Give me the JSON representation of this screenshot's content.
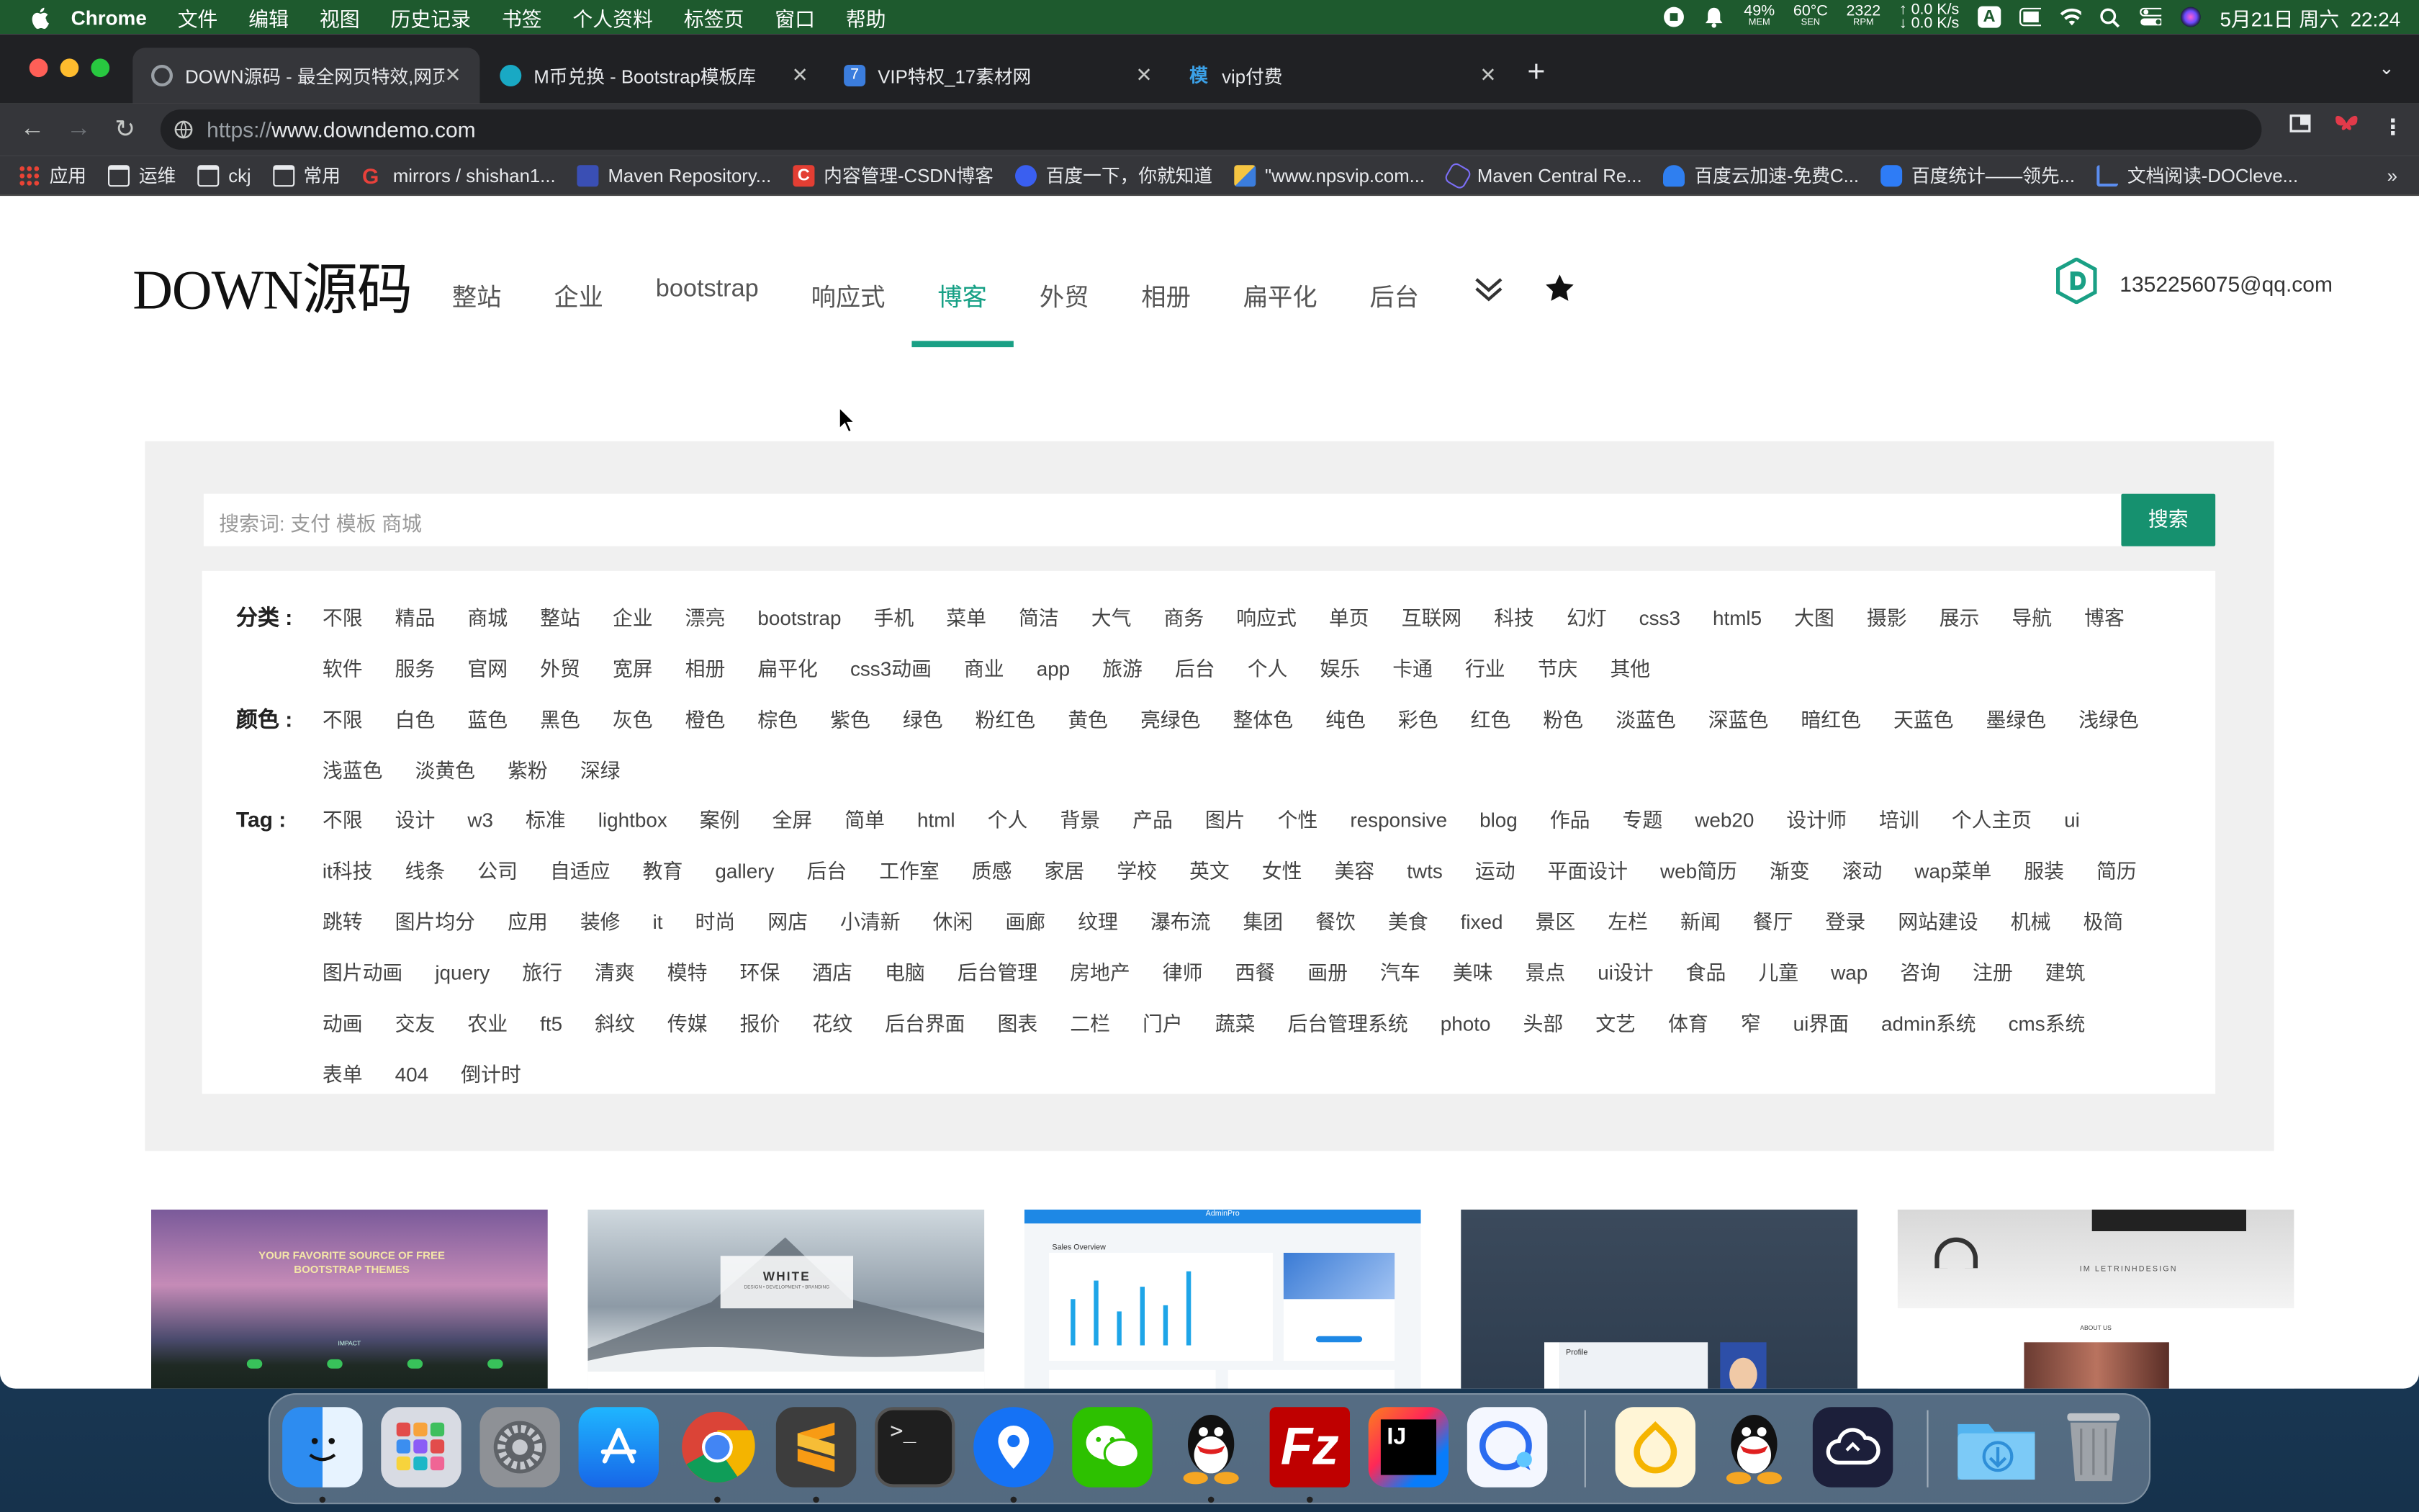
{
  "menubar": {
    "app": "Chrome",
    "items": [
      "文件",
      "编辑",
      "视图",
      "历史记录",
      "书签",
      "个人资料",
      "标签页",
      "窗口",
      "帮助"
    ],
    "mem": "49%",
    "mem_label": "MEM",
    "temp": "60°C",
    "temp_label": "SEN",
    "fan": "2322",
    "fan_label": "RPM",
    "net_up": "0.0 K/s",
    "net_down": "0.0 K/s",
    "input_method": "A",
    "datetime": "5月21日 周六  22:24"
  },
  "browser": {
    "tabs": [
      {
        "title": "DOWN源码 - 最全网页特效,网页",
        "active": true
      },
      {
        "title": "M币兑换 - Bootstrap模板库",
        "active": false
      },
      {
        "title": "VIP特权_17素材网",
        "active": false
      },
      {
        "title": "vip付费",
        "active": false
      }
    ],
    "url_protocol": "https://",
    "url_host": "www.downdemo.com",
    "bookmarks": [
      "应用",
      "运维",
      "ckj",
      "常用",
      "mirrors / shishan1...",
      "Maven Repository...",
      "内容管理-CSDN博客",
      "百度一下，你就知道",
      "\"www.npsvip.com...",
      "Maven Central Re...",
      "百度云加速-免费C...",
      "百度统计——领先...",
      "文档阅读-DOCleve..."
    ],
    "bookmarks_more": "»"
  },
  "site": {
    "logo": "DOWN源码",
    "nav": [
      {
        "label": "整站"
      },
      {
        "label": "企业"
      },
      {
        "label": "bootstrap"
      },
      {
        "label": "响应式"
      },
      {
        "label": "博客",
        "active": true
      },
      {
        "label": "外贸"
      },
      {
        "label": "相册"
      },
      {
        "label": "扁平化"
      },
      {
        "label": "后台"
      }
    ],
    "user_email": "1352256075@qq.com",
    "accent": "#16a085",
    "search_placeholder": "搜索词: 支付 模板 商城",
    "search_button": "搜索"
  },
  "filters": {
    "category": {
      "label": "分类 :",
      "options": [
        "不限",
        "精品",
        "商城",
        "整站",
        "企业",
        "漂亮",
        "bootstrap",
        "手机",
        "菜单",
        "简洁",
        "大气",
        "商务",
        "响应式",
        "单页",
        "互联网",
        "科技",
        "幻灯",
        "css3",
        "html5",
        "大图",
        "摄影",
        "展示",
        "导航",
        "博客",
        "软件",
        "服务",
        "官网",
        "外贸",
        "宽屏",
        "相册",
        "扁平化",
        "css3动画",
        "商业",
        "app",
        "旅游",
        "后台",
        "个人",
        "娱乐",
        "卡通",
        "行业",
        "节庆",
        "其他"
      ]
    },
    "color": {
      "label": "颜色 :",
      "options": [
        "不限",
        "白色",
        "蓝色",
        "黑色",
        "灰色",
        "橙色",
        "棕色",
        "紫色",
        "绿色",
        "粉红色",
        "黄色",
        "亮绿色",
        "整体色",
        "纯色",
        "彩色",
        "红色",
        "粉色",
        "淡蓝色",
        "深蓝色",
        "暗红色",
        "天蓝色",
        "墨绿色",
        "浅绿色",
        "浅蓝色",
        "淡黄色",
        "紫粉",
        "深绿"
      ]
    },
    "tag": {
      "label": "Tag :",
      "options": [
        "不限",
        "设计",
        "w3",
        "标准",
        "lightbox",
        "案例",
        "全屏",
        "简单",
        "html",
        "个人",
        "背景",
        "产品",
        "图片",
        "个性",
        "responsive",
        "blog",
        "作品",
        "专题",
        "web20",
        "设计师",
        "培训",
        "个人主页",
        "ui",
        "it科技",
        "线条",
        "公司",
        "自适应",
        "教育",
        "gallery",
        "后台",
        "工作室",
        "质感",
        "家居",
        "学校",
        "英文",
        "女性",
        "美容",
        "twts",
        "运动",
        "平面设计",
        "web简历",
        "渐变",
        "滚动",
        "wap菜单",
        "服装",
        "简历",
        "跳转",
        "图片均分",
        "应用",
        "装修",
        "it",
        "时尚",
        "网店",
        "小清新",
        "休闲",
        "画廊",
        "纹理",
        "瀑布流",
        "集团",
        "餐饮",
        "美食",
        "fixed",
        "景区",
        "左栏",
        "新闻",
        "餐厅",
        "登录",
        "网站建设",
        "机械",
        "极简",
        "图片动画",
        "jquery",
        "旅行",
        "清爽",
        "模特",
        "环保",
        "酒店",
        "电脑",
        "后台管理",
        "房地产",
        "律师",
        "西餐",
        "画册",
        "汽车",
        "美味",
        "景点",
        "ui设计",
        "食品",
        "儿童",
        "wap",
        "咨询",
        "注册",
        "建筑",
        "动画",
        "交友",
        "农业",
        "ft5",
        "斜纹",
        "传媒",
        "报价",
        "花纹",
        "后台界面",
        "图表",
        "二栏",
        "门户",
        "蔬菜",
        "后台管理系统",
        "photo",
        "头部",
        "文艺",
        "体育",
        "窄",
        "ui界面",
        "admin系统",
        "cms系统",
        "表单",
        "404",
        "倒计时"
      ]
    }
  },
  "thumbnails": [
    {
      "caption": "YOUR FAVORITE SOURCE OF FREE BOOTSTRAP THEMES",
      "sub": "IMPACT"
    },
    {
      "caption": "WHITE",
      "sub": "DESIGN • DEVELOPMENT • BRANDING"
    },
    {
      "caption": "AdminPro",
      "sub": "Sales Overview"
    },
    {
      "caption": "Profile",
      "sub": ""
    },
    {
      "caption": "IM LETRINHDESIGN",
      "sub": "ABOUT US"
    }
  ],
  "dock": [
    "finder-icon",
    "launchpad-icon",
    "settings-icon",
    "appstore-icon",
    "chrome-icon",
    "sublime-icon",
    "terminal-icon",
    "maps-pin-icon",
    "wechat-icon",
    "qq-icon",
    "filezilla-icon",
    "intellij-icon",
    "chat-bubble-icon",
    "orange-app-icon",
    "qq-2-icon",
    "cloud-icon",
    "downloads-folder-icon",
    "trash-icon"
  ]
}
